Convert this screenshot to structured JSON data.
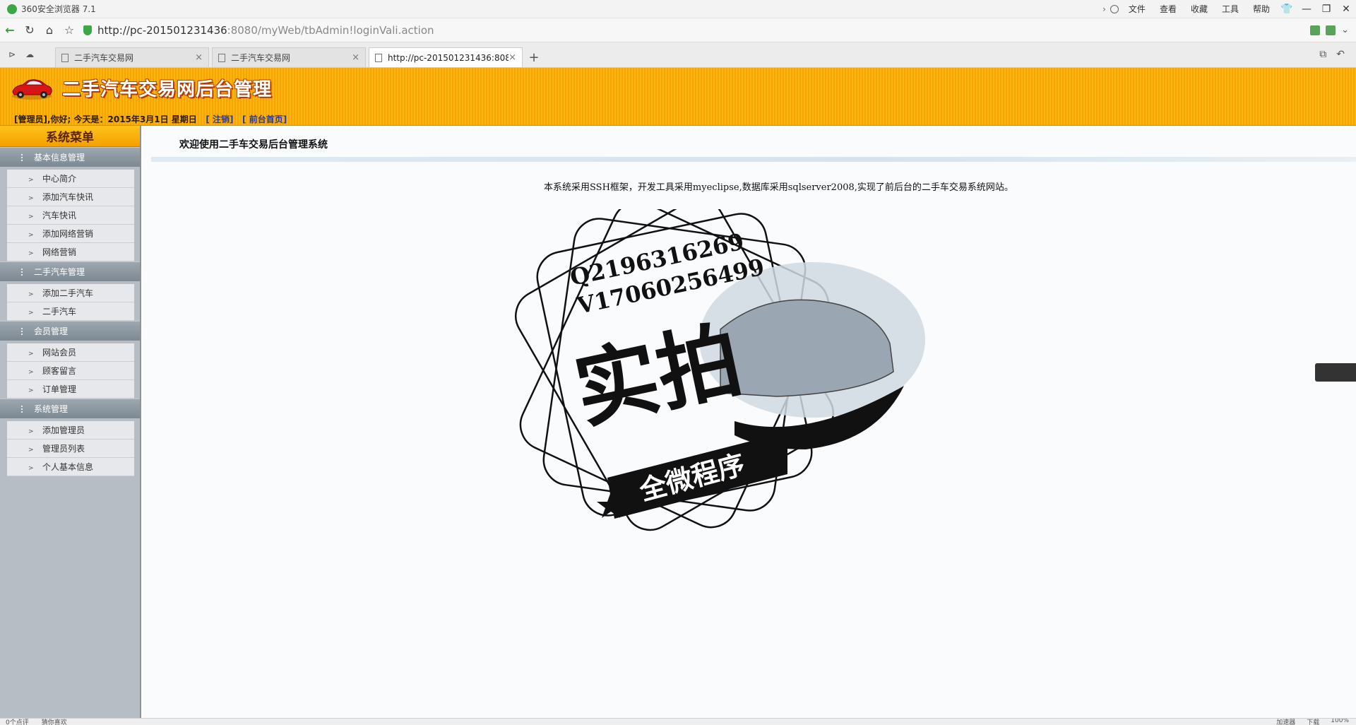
{
  "browser": {
    "title": "360安全浏览器 7.1",
    "menus": [
      "文件",
      "查看",
      "收藏",
      "工具",
      "帮助"
    ],
    "url_host": "http://pc-201501231436",
    "url_path": ":8080/myWeb/tbAdmin!loginVali.action",
    "tabs": [
      {
        "label": "二手汽车交易网",
        "active": false
      },
      {
        "label": "二手汽车交易网",
        "active": false
      },
      {
        "label": "http://pc-201501231436:808",
        "active": true
      }
    ],
    "new_tab": "+"
  },
  "header": {
    "site_title": "二手汽车交易网后台管理",
    "greeting": "[管理员],你好; 今天是：2015年3月1日 星期日",
    "logout": "[ 注销]",
    "front_home": "[ 前台首页]"
  },
  "sidebar": {
    "title": "系统菜单",
    "groups": [
      {
        "label": "基本信息管理",
        "items": [
          "中心简介",
          "添加汽车快讯",
          "汽车快讯",
          "添加网络营销",
          "网络营销"
        ]
      },
      {
        "label": "二手汽车管理",
        "items": [
          "添加二手汽车",
          "二手汽车"
        ]
      },
      {
        "label": "会员管理",
        "items": [
          "网站会员",
          "顾客留言",
          "订单管理"
        ]
      },
      {
        "label": "系统管理",
        "items": [
          "添加管理员",
          "管理员列表",
          "个人基本信息"
        ]
      }
    ]
  },
  "main": {
    "welcome": "欢迎使用二手车交易后台管理系统",
    "description": "本系统采用SSH框架，开发工具采用myeclipse,数据库采用sqlserver2008,实现了前后台的二手车交易系统网站。"
  },
  "watermark": {
    "line1": "Q2196316269",
    "line2": "V17060256499",
    "big": "实拍",
    "banner": "全微程序"
  },
  "statusbar": {
    "left1": "0个点评",
    "left2": "猜你喜欢",
    "right1": "加速器",
    "right2": "下载",
    "zoom": "100%"
  },
  "colors": {
    "banner_orange": "#f6a400",
    "sidebar_bg": "#b7bdc5",
    "group_header": "#7d8992"
  }
}
